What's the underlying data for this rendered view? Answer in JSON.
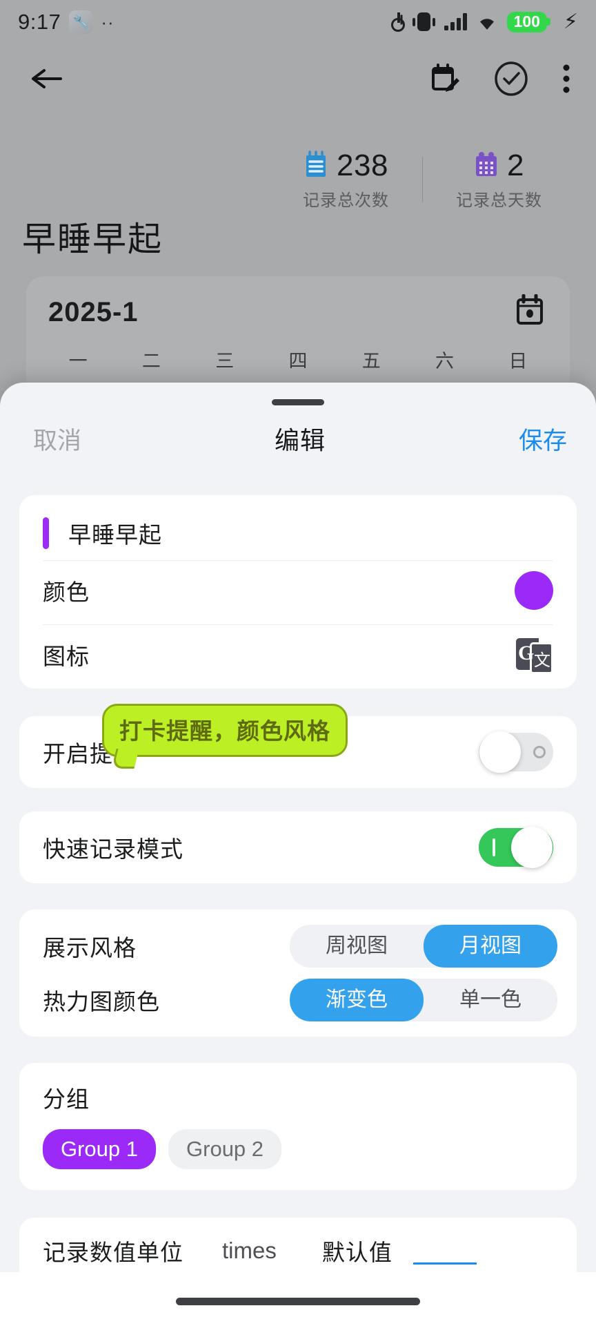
{
  "status_bar": {
    "time": "9:17",
    "wrench_icon": "wrench-icon",
    "overflow_dots": "··",
    "battery_percent": "100",
    "icons": [
      "key-icon",
      "vibrate-icon",
      "signal-icon",
      "wifi-icon",
      "battery-icon",
      "charging-bolt-icon"
    ]
  },
  "app": {
    "nav": {
      "back": "back-arrow-icon",
      "calendar_edit": "calendar-edit-icon",
      "check": "check-circle-icon",
      "more": "more-vertical-icon"
    },
    "stats": [
      {
        "icon": "notepad-icon",
        "value": "238",
        "label": "记录总次数",
        "color": "#2b8fd0"
      },
      {
        "icon": "calendar-icon",
        "value": "2",
        "label": "记录总天数",
        "color": "#7a52c7"
      }
    ],
    "habit_title": "早睡早起",
    "calendar": {
      "month": "2025-1",
      "picker_icon": "calendar-picker-icon",
      "weekdays": [
        "一",
        "二",
        "三",
        "四",
        "五",
        "六",
        "日"
      ]
    }
  },
  "sheet": {
    "cancel_label": "取消",
    "title": "编辑",
    "save_label": "保存",
    "save_color": "#1a8cf0",
    "basic": {
      "name_value": "早睡早起",
      "caret_color": "#9b2bf5",
      "color_label": "颜色",
      "color_value": "#9b29f7",
      "icon_label": "图标",
      "icon_name": "google-translate-icon"
    },
    "reminder": {
      "label": "开启提醒",
      "enabled": false
    },
    "tooltip": {
      "text": "打卡提醒，颜色风格",
      "bg": "#bdf024",
      "border": "#8aa815",
      "text_color": "#5e6b12"
    },
    "quick_record": {
      "label": "快速记录模式",
      "enabled": true,
      "on_color": "#35c759"
    },
    "display_style": {
      "label": "展示风格",
      "options": [
        "周视图",
        "月视图"
      ],
      "selected": "月视图"
    },
    "heatmap_color": {
      "label": "热力图颜色",
      "options": [
        "渐变色",
        "单一色"
      ],
      "selected": "渐变色"
    },
    "accent_color": "#33a1ec",
    "groups": {
      "title": "分组",
      "chips": [
        "Group 1",
        "Group 2"
      ],
      "selected": "Group 1",
      "selected_color": "#9b29f7"
    },
    "unit": {
      "label": "记录数值单位",
      "value": "times",
      "default_label": "默认值",
      "default_value": ""
    }
  }
}
